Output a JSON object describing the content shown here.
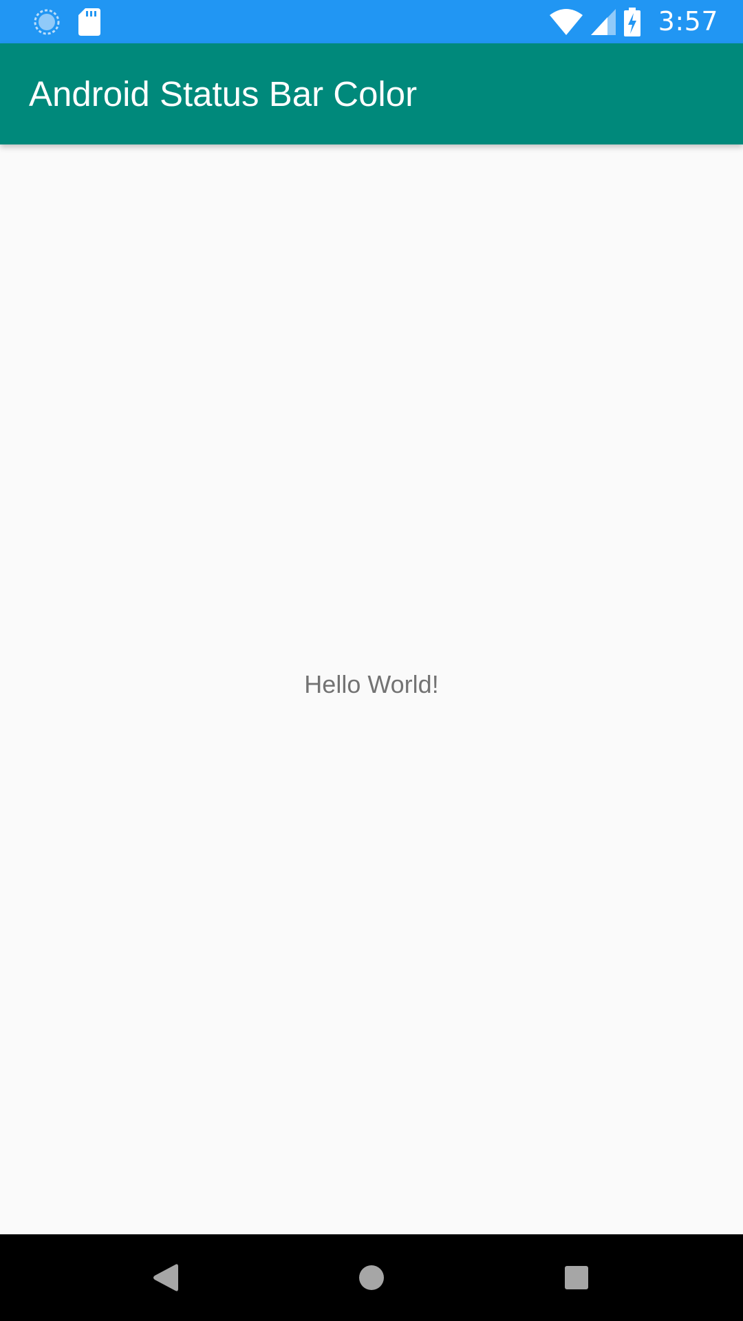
{
  "status_bar": {
    "time": "3:57",
    "background_color": "#2196F3",
    "icons": [
      "sync-icon",
      "sd-card-icon",
      "wifi-icon",
      "cell-signal-icon",
      "battery-charging-icon"
    ]
  },
  "app_bar": {
    "title": "Android Status Bar Color",
    "background_color": "#00897B"
  },
  "content": {
    "message": "Hello World!"
  },
  "nav_bar": {
    "buttons": [
      "back",
      "home",
      "recents"
    ]
  }
}
